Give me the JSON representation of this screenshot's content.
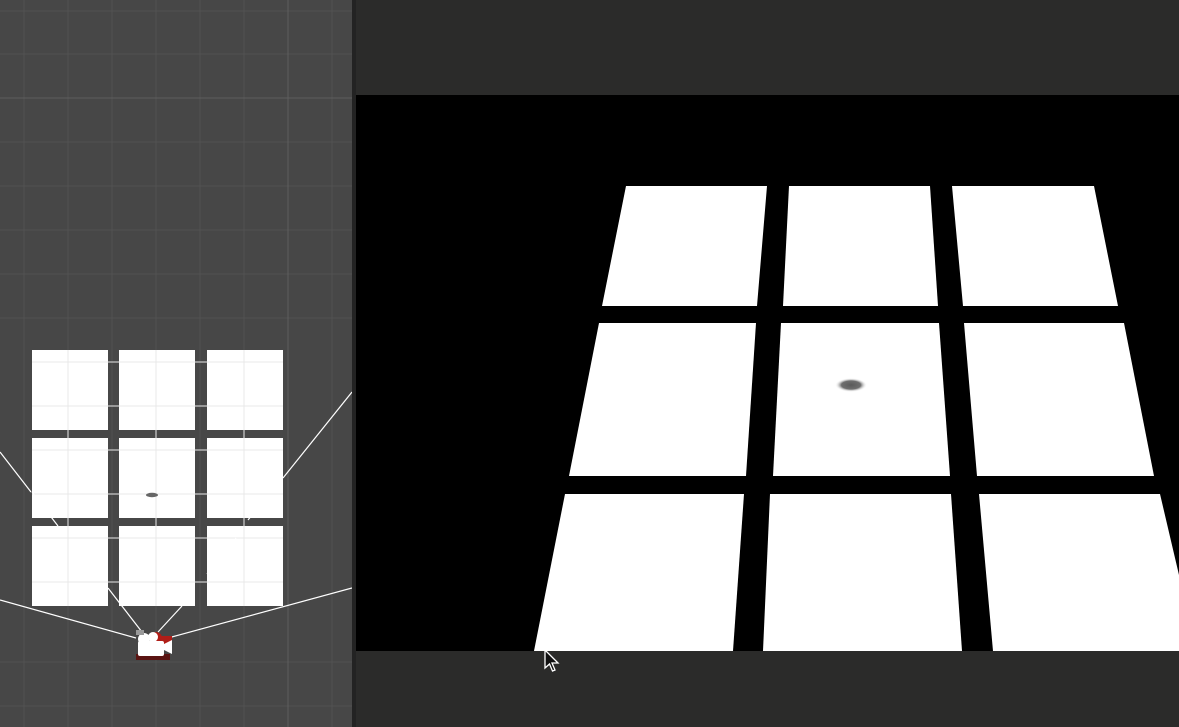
{
  "colors": {
    "scene_background": "#474747",
    "grid_line": "#545454",
    "tile": "#ffffff",
    "tile_grid": "#e6e6e6",
    "frustum_line": "#ffffff",
    "game_background": "#000000",
    "toolbar": "#2b2b2a",
    "divider": "#232323",
    "ball_shadow": "#6a6a6a",
    "camera_gizmo_body": "#ffffff",
    "camera_gizmo_accent": "#b01e18"
  },
  "icons": {
    "camera": "camera-gizmo-icon",
    "cursor": "mouse-pointer-icon"
  },
  "scene": {
    "tile_grid": {
      "rows": 3,
      "cols": 3
    },
    "shadow_tile": {
      "row": 2,
      "col": 2
    }
  },
  "game": {
    "tile_grid": {
      "rows": 3,
      "cols": 3
    },
    "shadow_tile": {
      "row": 2,
      "col": 2
    }
  }
}
